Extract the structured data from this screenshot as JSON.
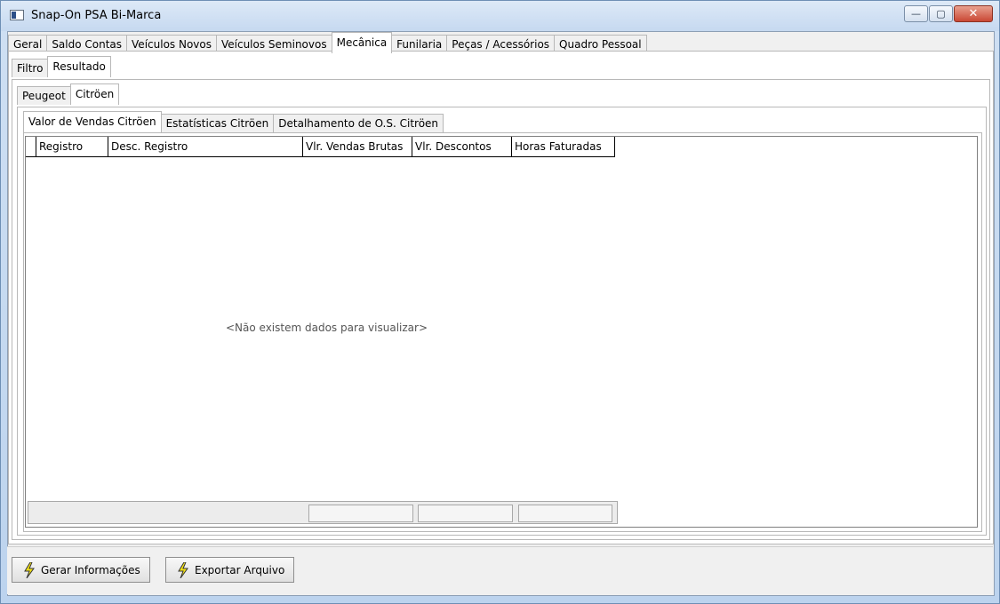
{
  "window": {
    "title": "Snap-On PSA Bi-Marca"
  },
  "main_tabs": [
    "Geral",
    "Saldo Contas",
    "Veículos Novos",
    "Veículos Seminovos",
    "Mecânica",
    "Funilaria",
    "Peças / Acessórios",
    "Quadro Pessoal"
  ],
  "main_tab_active": "Mecânica",
  "sub_tabs": [
    "Filtro",
    "Resultado"
  ],
  "brand_tabs": [
    "Peugeot",
    "Citröen"
  ],
  "report_tabs": [
    "Valor de Vendas Citröen",
    "Estatísticas Citröen",
    "Detalhamento de O.S. Citröen"
  ],
  "grid": {
    "columns": [
      "Registro",
      "Desc. Registro",
      "Vlr. Vendas Brutas",
      "Vlr. Descontos",
      "Horas Faturadas"
    ],
    "empty_message": "<Não existem dados para visualizar>"
  },
  "buttons": {
    "generate": "Gerar Informações",
    "export": "Exportar Arquivo"
  },
  "colors": {
    "bolt": "#f4e316",
    "title_bg": "#c6d9f0",
    "close": "#c94734"
  }
}
